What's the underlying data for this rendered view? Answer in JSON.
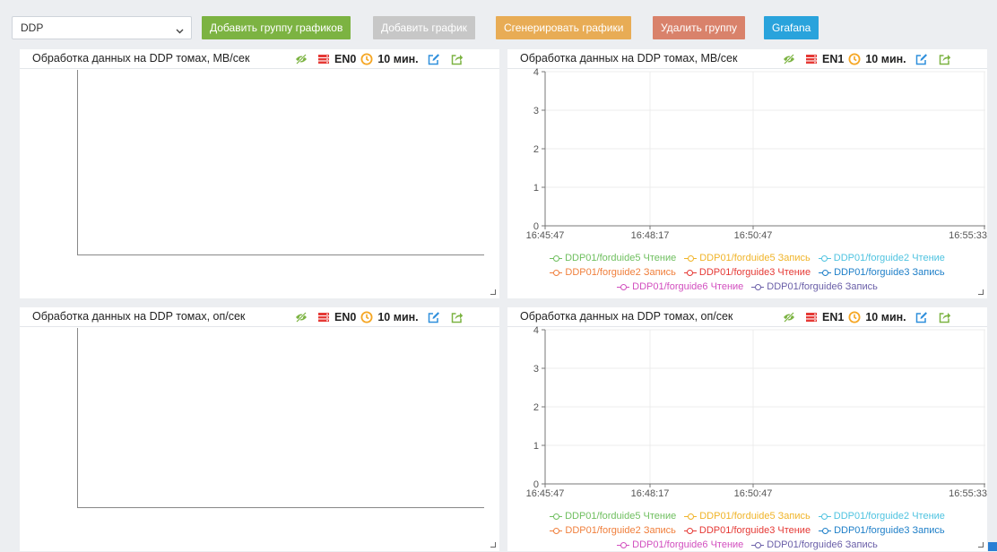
{
  "toolbar": {
    "group_select": {
      "value": "DDP"
    },
    "buttons": [
      {
        "name": "add-chart-group-button",
        "label": "Добавить группу графиков",
        "color": "#7cb342"
      },
      {
        "name": "add-chart-button",
        "label": "Добавить график",
        "color": "#c7c7c7"
      },
      {
        "name": "generate-charts-button",
        "label": "Сгенерировать графики",
        "color": "#e8ac55"
      },
      {
        "name": "delete-group-button",
        "label": "Удалить группу",
        "color": "#d9826b"
      },
      {
        "name": "grafana-button",
        "label": "Grafana",
        "color": "#29a3dc"
      }
    ]
  },
  "panels": [
    {
      "title": "Обработка данных на DDP томах, MB/сек",
      "node": "EN0",
      "interval": "10 мин.",
      "has_chart": false
    },
    {
      "title": "Обработка данных на DDP томах, MB/сек",
      "node": "EN1",
      "interval": "10 мин.",
      "has_chart": true
    },
    {
      "title": "Обработка данных на DDP томах, оп/сек",
      "node": "EN0",
      "interval": "10 мин.",
      "has_chart": false
    },
    {
      "title": "Обработка данных на DDP томах, оп/сек",
      "node": "EN1",
      "interval": "10 мин.",
      "has_chart": true
    }
  ],
  "icons": {
    "visibility": "eye-slash-icon",
    "server": "server-icon",
    "clock": "clock-icon",
    "edit": "edit-icon",
    "export": "export-icon"
  },
  "colors": {
    "eye": "#7cb342",
    "server": "#e53935",
    "clock": "#f5a623",
    "edit": "#2f8fdc",
    "export": "#7cb342"
  },
  "chart_data": [
    {
      "type": "line",
      "title": "Обработка данных на DDP томах, MB/сек",
      "x_ticks": [
        "16:45:47",
        "16:48:17",
        "16:50:47",
        "16:55:33"
      ],
      "ylim": [
        0,
        4
      ],
      "y_ticks": [
        "0",
        "1",
        "2",
        "3",
        "4"
      ],
      "grid": true,
      "legend_position": "bottom",
      "series": [
        {
          "name": "DDP01/forduide5 Чтение",
          "color": "#6fbf5f",
          "values": []
        },
        {
          "name": "DDP01/forduide5 Запись",
          "color": "#f0b429",
          "values": []
        },
        {
          "name": "DDP01/forguide2 Чтение",
          "color": "#4fc3e0",
          "values": []
        },
        {
          "name": "DDP01/forguide2 Запись",
          "color": "#f07f3c",
          "values": []
        },
        {
          "name": "DDP01/forguide3 Чтение",
          "color": "#e53935",
          "values": []
        },
        {
          "name": "DDP01/forguide3 Запись",
          "color": "#1e7fc8",
          "values": []
        },
        {
          "name": "DDP01/forguide6 Чтение",
          "color": "#d24fbf",
          "values": []
        },
        {
          "name": "DDP01/forguide6 Запись",
          "color": "#6a5fa8",
          "values": []
        }
      ]
    },
    {
      "type": "line",
      "title": "Обработка данных на DDP томах, оп/сек",
      "x_ticks": [
        "16:45:47",
        "16:48:17",
        "16:50:47",
        "16:55:33"
      ],
      "ylim": [
        0,
        4
      ],
      "y_ticks": [
        "0",
        "1",
        "2",
        "3",
        "4"
      ],
      "grid": true,
      "legend_position": "bottom",
      "series": [
        {
          "name": "DDP01/forduide5 Чтение",
          "color": "#6fbf5f",
          "values": []
        },
        {
          "name": "DDP01/forduide5 Запись",
          "color": "#f0b429",
          "values": []
        },
        {
          "name": "DDP01/forguide2 Чтение",
          "color": "#4fc3e0",
          "values": []
        },
        {
          "name": "DDP01/forguide2 Запись",
          "color": "#f07f3c",
          "values": []
        },
        {
          "name": "DDP01/forguide3 Чтение",
          "color": "#e53935",
          "values": []
        },
        {
          "name": "DDP01/forguide3 Запись",
          "color": "#1e7fc8",
          "values": []
        },
        {
          "name": "DDP01/forguide6 Чтение",
          "color": "#d24fbf",
          "values": []
        },
        {
          "name": "DDP01/forguide6 Запись",
          "color": "#6a5fa8",
          "values": []
        }
      ]
    }
  ]
}
